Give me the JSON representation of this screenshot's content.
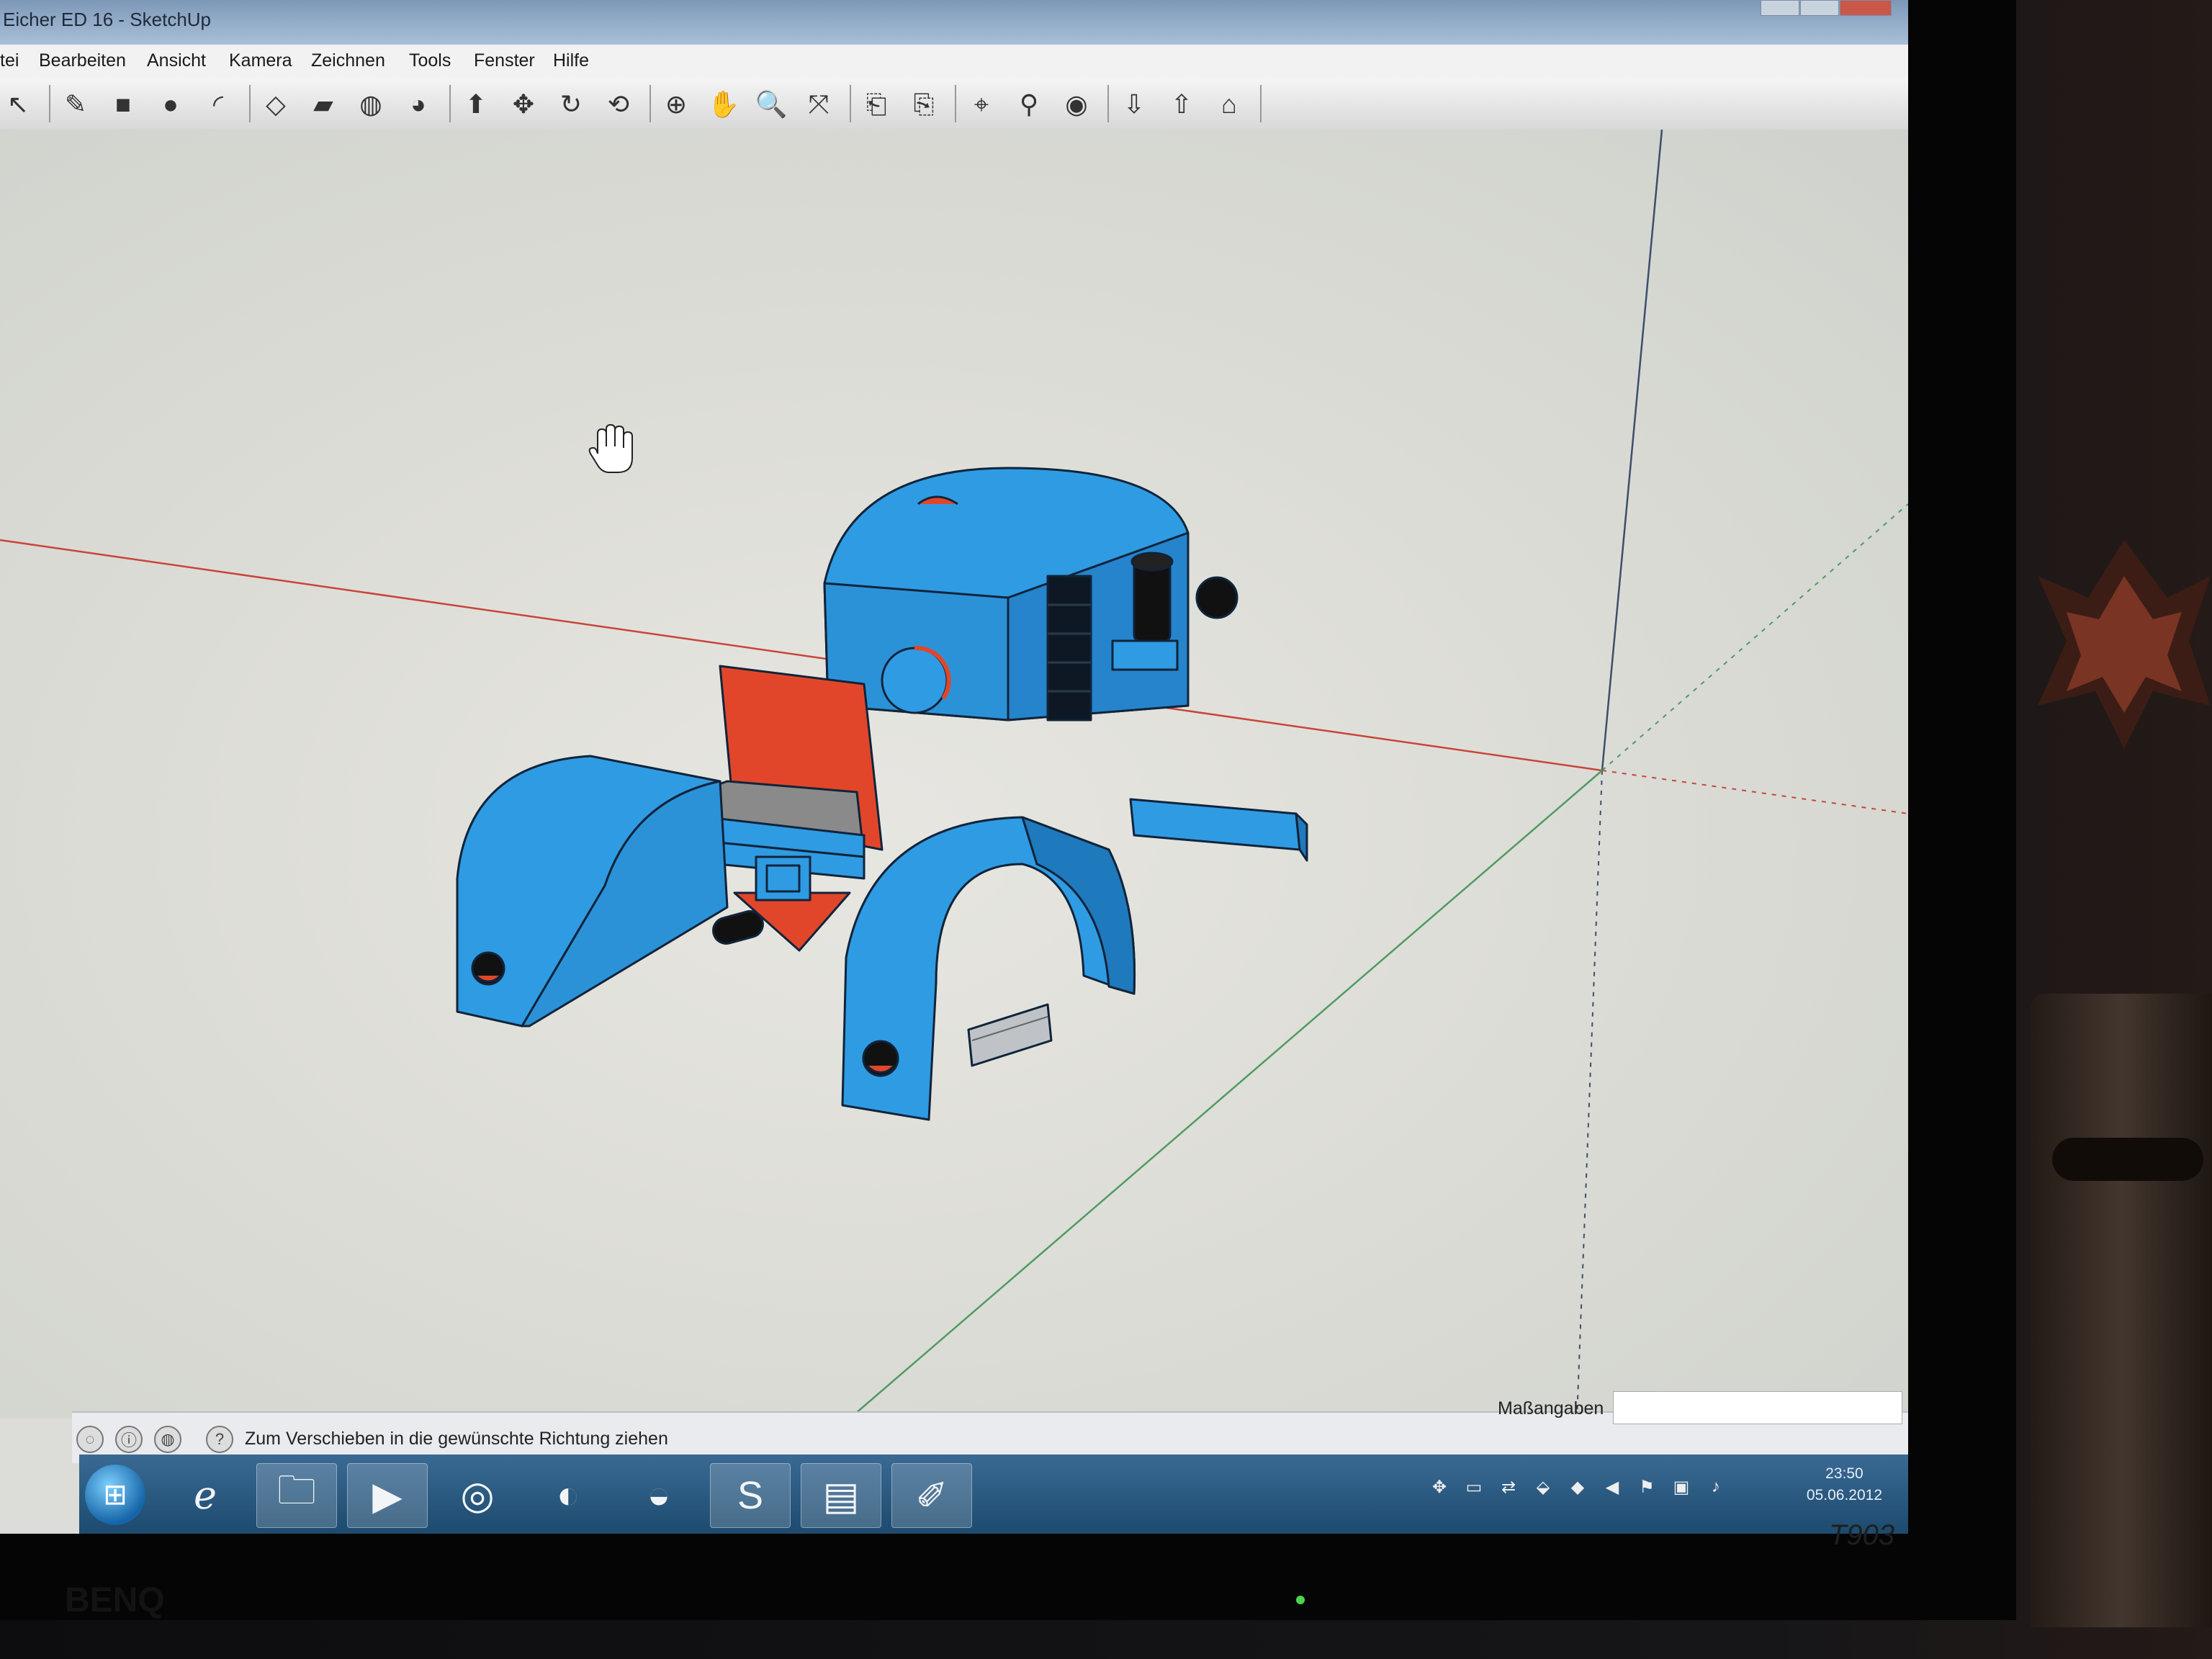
{
  "window": {
    "title": "Eicher ED 16 - SketchUp"
  },
  "menubar": {
    "items": [
      "tei",
      "Bearbeiten",
      "Ansicht",
      "Kamera",
      "Zeichnen",
      "Tools",
      "Fenster",
      "Hilfe"
    ]
  },
  "toolbar": {
    "tools": [
      {
        "name": "select-tool",
        "glyph": "↖"
      },
      {
        "name": "pencil-tool",
        "glyph": "✎"
      },
      {
        "name": "rectangle-tool",
        "glyph": "■"
      },
      {
        "name": "circle-tool",
        "glyph": "●"
      },
      {
        "name": "arc-tool",
        "glyph": "◜"
      },
      {
        "name": "make-component-tool",
        "glyph": "◇"
      },
      {
        "name": "eraser-tool",
        "glyph": "▰"
      },
      {
        "name": "tape-measure-tool",
        "glyph": "◍"
      },
      {
        "name": "paint-bucket-tool",
        "glyph": "◕"
      },
      {
        "name": "push-pull-tool",
        "glyph": "⬆"
      },
      {
        "name": "move-tool",
        "glyph": "✥"
      },
      {
        "name": "rotate-tool",
        "glyph": "↻"
      },
      {
        "name": "offset-tool",
        "glyph": "⟲"
      },
      {
        "name": "orbit-tool",
        "glyph": "⊕"
      },
      {
        "name": "pan-tool",
        "glyph": "✋"
      },
      {
        "name": "zoom-tool",
        "glyph": "🔍"
      },
      {
        "name": "zoom-extents-tool",
        "glyph": "⤧"
      },
      {
        "name": "previous-view-tool",
        "glyph": "⎗"
      },
      {
        "name": "next-view-tool",
        "glyph": "⎘"
      },
      {
        "name": "position-camera-tool",
        "glyph": "⌖"
      },
      {
        "name": "walk-tool",
        "glyph": "⚲"
      },
      {
        "name": "look-around-tool",
        "glyph": "◉"
      },
      {
        "name": "get-models-tool",
        "glyph": "⇩"
      },
      {
        "name": "share-model-tool",
        "glyph": "⇧"
      },
      {
        "name": "warehouse-tool",
        "glyph": "⌂"
      }
    ]
  },
  "statusbar": {
    "hint": "Zum Verschieben in die gewünschte Richtung ziehen",
    "measurements_label": "Maßangaben",
    "measurements_value": ""
  },
  "taskbar": {
    "apps": [
      {
        "name": "internet-explorer-icon",
        "glyph": "ℯ",
        "active": false
      },
      {
        "name": "file-explorer-icon",
        "glyph": "🗀",
        "active": true
      },
      {
        "name": "media-player-icon",
        "glyph": "▶",
        "active": true
      },
      {
        "name": "chrome-icon",
        "glyph": "◎",
        "active": false
      },
      {
        "name": "firefox-icon",
        "glyph": "◐",
        "active": false
      },
      {
        "name": "google-earth-icon",
        "glyph": "◒",
        "active": false
      },
      {
        "name": "skype-icon",
        "glyph": "S",
        "active": true
      },
      {
        "name": "archive-icon",
        "glyph": "▤",
        "active": true
      },
      {
        "name": "sketchup-icon",
        "glyph": "✐",
        "active": true
      }
    ],
    "clock_time": "23:50",
    "clock_date": "05.06.2012"
  },
  "monitor": {
    "brand_right": "T903",
    "brand_left": "BENQ"
  },
  "colors": {
    "model_blue": "#2f9be3",
    "model_red": "#e2462a",
    "axis_red": "#c8453a",
    "axis_green": "#4f9a62",
    "axis_blue": "#3c4f6a"
  }
}
